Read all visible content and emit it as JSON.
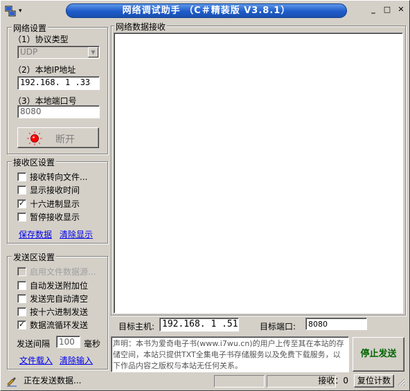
{
  "window": {
    "title": "网络调试助手 （C＃精装版 V3.8.1）",
    "min": "_",
    "max": "□",
    "close": "✕",
    "menu_arrow": "▾"
  },
  "network": {
    "group_label": "网络设置",
    "protocol_label": "（1）协议类型",
    "protocol_value": "UDP",
    "ip_label": "（2）本地IP地址",
    "ip_value": "192.168. 1 .33",
    "port_label": "（3）本地端口号",
    "port_value": "8080",
    "connect_button": "断开"
  },
  "receive": {
    "group_label": "接收区设置",
    "options": [
      {
        "label": "接收转向文件...",
        "checked": false
      },
      {
        "label": "显示接收时间",
        "checked": false
      },
      {
        "label": "十六进制显示",
        "checked": true
      },
      {
        "label": "暂停接收显示",
        "checked": false
      }
    ],
    "save_link": "保存数据",
    "clear_link": "清除显示"
  },
  "send": {
    "group_label": "发送区设置",
    "options": [
      {
        "label": "启用文件数据源...",
        "checked": false,
        "disabled": true
      },
      {
        "label": "自动发送附加位",
        "checked": false
      },
      {
        "label": "发送完自动清空",
        "checked": false
      },
      {
        "label": "按十六进制发送",
        "checked": false
      },
      {
        "label": "数据流循环发送",
        "checked": true
      }
    ],
    "interval_label": "发送间隔",
    "interval_value": "100",
    "interval_unit": "毫秒",
    "file_link": "文件载入",
    "clear_link": "清除输入"
  },
  "data_area": {
    "group_label": "网络数据接收"
  },
  "target": {
    "host_label": "目标主机:",
    "host_value": "192.168. 1 .51",
    "port_label": "目标端口:",
    "port_value": "8080"
  },
  "send_text": "声明：本书为爱奇电子书(www.i7wu.cn)的用户上传至其在本站的存储空间，本站只提供TXT全集电子书存储服务以及免费下载服务，以下作品内容之版权与本站无任何关系。",
  "send_button": "停止发送",
  "status": {
    "text": "正在发送数据...",
    "recv_label": "接收：0",
    "reset_button": "复位计数"
  },
  "colors": {
    "title_blue": "#1e5cc9",
    "send_button_text": "#006400",
    "led_red": "#ff0000"
  }
}
